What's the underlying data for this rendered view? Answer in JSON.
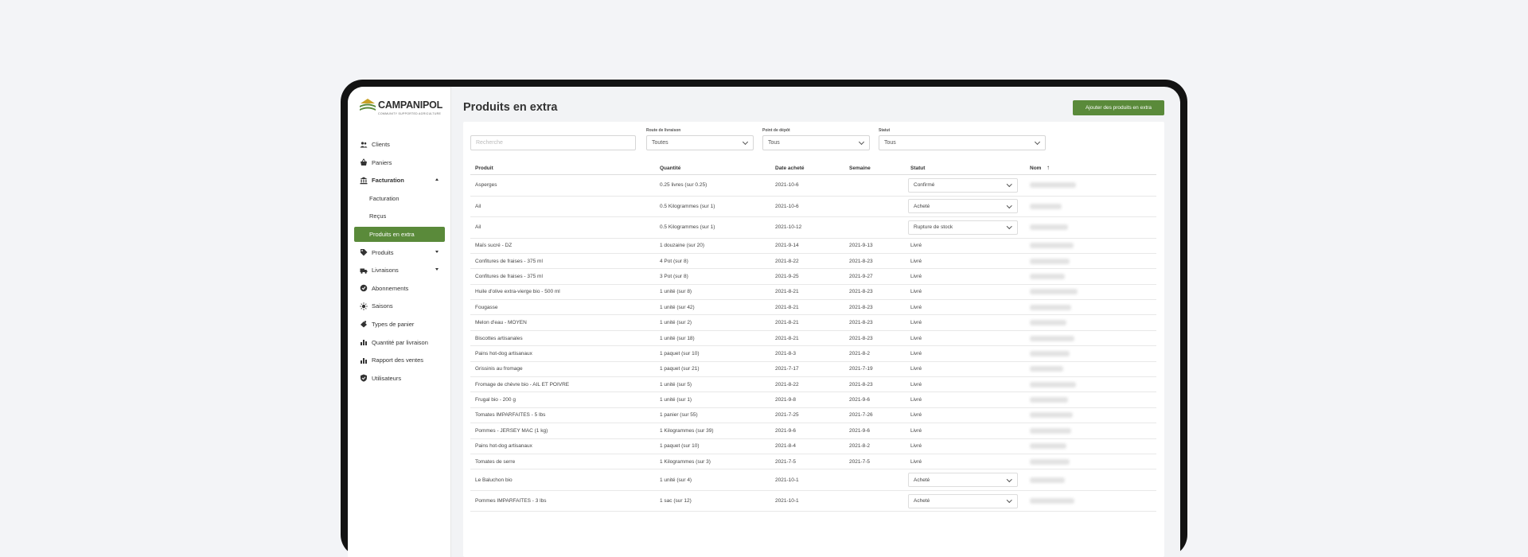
{
  "app": {
    "name": "CAMPANIPOL",
    "tagline": "COMMUNITY SUPPORTED AGRICULTURE",
    "brand_color": "#5a8a3a"
  },
  "sidebar": {
    "items": [
      {
        "label": "Clients",
        "icon": "users-icon"
      },
      {
        "label": "Paniers",
        "icon": "basket-icon"
      },
      {
        "label": "Facturation",
        "icon": "bank-icon"
      },
      {
        "label": "Facturation"
      },
      {
        "label": "Reçus"
      },
      {
        "label": "Produits en extra"
      },
      {
        "label": "Produits",
        "icon": "tag-icon"
      },
      {
        "label": "Livraisons",
        "icon": "truck-icon"
      },
      {
        "label": "Abonnements",
        "icon": "subscription-icon"
      },
      {
        "label": "Saisons",
        "icon": "sun-icon"
      },
      {
        "label": "Types de panier",
        "icon": "basket-type-icon"
      },
      {
        "label": "Quantité par livraison",
        "icon": "bar-chart-icon"
      },
      {
        "label": "Rapport des ventes",
        "icon": "bar-chart-icon"
      },
      {
        "label": "Utilisateurs",
        "icon": "shield-icon"
      }
    ]
  },
  "page": {
    "title": "Produits en extra",
    "add_button": "Ajouter des produits en extra"
  },
  "filters": {
    "search_placeholder": "Recherche",
    "route_label": "Route de livraison",
    "route_value": "Toutes",
    "point_label": "Point de dépôt",
    "point_value": "Tous",
    "status_label": "Statut",
    "status_value": "Tous"
  },
  "table": {
    "headers": [
      "Produit",
      "Quantité",
      "Date acheté",
      "Semaine",
      "Statut",
      "Nom"
    ],
    "sort_indicator": "↑",
    "rows": [
      {
        "product": "Asperges",
        "qty": "0.25 livres (sur 0.25)",
        "date": "2021-10-6",
        "week": "",
        "status": "Confirmé",
        "select": true
      },
      {
        "product": "Ail",
        "qty": "0.5 Kilogrammes (sur 1)",
        "date": "2021-10-6",
        "week": "",
        "status": "Acheté",
        "select": true
      },
      {
        "product": "Ail",
        "qty": "0.5 Kilogrammes (sur 1)",
        "date": "2021-10-12",
        "week": "",
        "status": "Rupture de stock",
        "select": true
      },
      {
        "product": "Maïs sucré - DZ",
        "qty": "1 douzaine (sur 20)",
        "date": "2021-9-14",
        "week": "2021-9-13",
        "status": "Livré",
        "select": false
      },
      {
        "product": "Confitures de fraises - 375 ml",
        "qty": "4 Pot (sur 8)",
        "date": "2021-8-22",
        "week": "2021-8-23",
        "status": "Livré",
        "select": false
      },
      {
        "product": "Confitures de fraises - 375 ml",
        "qty": "3 Pot (sur 8)",
        "date": "2021-9-25",
        "week": "2021-9-27",
        "status": "Livré",
        "select": false
      },
      {
        "product": "Huile d'olive extra-vierge bio - 500 ml",
        "qty": "1 unité (sur 8)",
        "date": "2021-8-21",
        "week": "2021-8-23",
        "status": "Livré",
        "select": false
      },
      {
        "product": "Fougasse",
        "qty": "1 unité (sur 42)",
        "date": "2021-8-21",
        "week": "2021-8-23",
        "status": "Livré",
        "select": false
      },
      {
        "product": "Melon d'eau - MOYEN",
        "qty": "1 unité (sur 2)",
        "date": "2021-8-21",
        "week": "2021-8-23",
        "status": "Livré",
        "select": false
      },
      {
        "product": "Biscottes artisanales",
        "qty": "1 unité (sur 18)",
        "date": "2021-8-21",
        "week": "2021-8-23",
        "status": "Livré",
        "select": false
      },
      {
        "product": "Pains hot-dog artisanaux",
        "qty": "1 paquet (sur 10)",
        "date": "2021-8-3",
        "week": "2021-8-2",
        "status": "Livré",
        "select": false
      },
      {
        "product": "Grissinis au fromage",
        "qty": "1 paquet (sur 21)",
        "date": "2021-7-17",
        "week": "2021-7-19",
        "status": "Livré",
        "select": false
      },
      {
        "product": "Fromage de chèvre bio - AIL ET POIVRE",
        "qty": "1 unité (sur 5)",
        "date": "2021-8-22",
        "week": "2021-8-23",
        "status": "Livré",
        "select": false
      },
      {
        "product": "Frugal bio - 200 g",
        "qty": "1 unité (sur 1)",
        "date": "2021-9-8",
        "week": "2021-9-6",
        "status": "Livré",
        "select": false
      },
      {
        "product": "Tomates IMPARFAITES - 5 lbs",
        "qty": "1 panier (sur 55)",
        "date": "2021-7-25",
        "week": "2021-7-26",
        "status": "Livré",
        "select": false
      },
      {
        "product": "Pommes - JERSEY MAC (1 kg)",
        "qty": "1 Kilogrammes (sur 39)",
        "date": "2021-9-6",
        "week": "2021-9-6",
        "status": "Livré",
        "select": false
      },
      {
        "product": "Pains hot-dog artisanaux",
        "qty": "1 paquet (sur 10)",
        "date": "2021-8-4",
        "week": "2021-8-2",
        "status": "Livré",
        "select": false
      },
      {
        "product": "Tomates de serre",
        "qty": "1 Kilogrammes (sur 3)",
        "date": "2021-7-5",
        "week": "2021-7-5",
        "status": "Livré",
        "select": false
      },
      {
        "product": "Le Baluchon bio",
        "qty": "1 unité (sur 4)",
        "date": "2021-10-1",
        "week": "",
        "status": "Acheté",
        "select": true
      },
      {
        "product": "Pommes IMPARFAITES - 3 lbs",
        "qty": "1 sac (sur 12)",
        "date": "2021-10-1",
        "week": "",
        "status": "Acheté",
        "select": true
      }
    ]
  }
}
